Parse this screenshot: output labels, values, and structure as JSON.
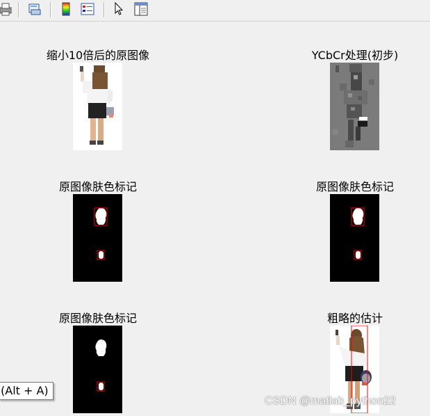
{
  "toolbar": {
    "items": [
      {
        "name": "print-icon"
      },
      {
        "name": "print-preview-icon"
      },
      {
        "name": "colorbar-icon"
      },
      {
        "name": "legend-icon"
      },
      {
        "name": "pointer-icon"
      },
      {
        "name": "property-editor-icon"
      }
    ]
  },
  "figures": {
    "p1_title": "缩小10倍后的原图像",
    "p2_title": "YCbCr处理(初步)",
    "p3_title": "原图像肤色标记",
    "p4_title": "原图像肤色标记",
    "p5_title": "原图像肤色标记",
    "p6_title": "粗略的估计"
  },
  "tooltip": "(Alt + A)",
  "watermark": "CSDN @matlab_python22",
  "colors": {
    "background": "#f0f0f0",
    "marker": "#ff0000",
    "mask_bg": "#000000",
    "mask_fg": "#ffffff"
  }
}
